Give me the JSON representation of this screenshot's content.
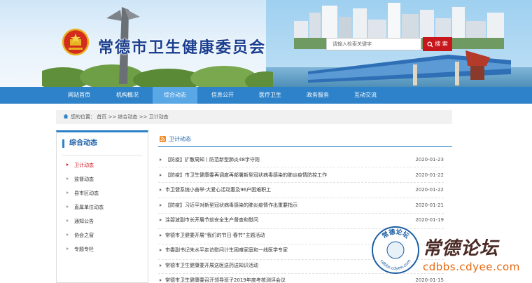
{
  "header": {
    "site_title": "常德市卫生健康委员会",
    "search": {
      "placeholder": "请输入检索关键字",
      "button_label": "搜 索"
    }
  },
  "nav": {
    "items": [
      {
        "label": "网站首页",
        "active": false
      },
      {
        "label": "机构概况",
        "active": false
      },
      {
        "label": "综合动态",
        "active": true
      },
      {
        "label": "信息公开",
        "active": false
      },
      {
        "label": "医疗卫生",
        "active": false
      },
      {
        "label": "政务服务",
        "active": false
      },
      {
        "label": "互动交流",
        "active": false
      }
    ]
  },
  "breadcrumb": {
    "text": "您的位置： 首页 >> 综合动态 >> 卫计动态"
  },
  "sidebar": {
    "title": "综合动态",
    "items": [
      {
        "label": "卫计动态",
        "active": true
      },
      {
        "label": "监督动态",
        "active": false
      },
      {
        "label": "县市区动态",
        "active": false
      },
      {
        "label": "直属单位动态",
        "active": false
      },
      {
        "label": "通知公告",
        "active": false
      },
      {
        "label": "协会之窗",
        "active": false
      },
      {
        "label": "专题专栏",
        "active": false
      }
    ]
  },
  "main": {
    "title": "卫计动态",
    "news": [
      {
        "title": "【防疫】扩散周知丨防范新型肺炎48字守则",
        "date": "2020-01-23"
      },
      {
        "title": "【防疫】市卫生健康委再调度再部署新型冠状病毒感染的肺炎疫情防控工作",
        "date": "2020-01-22"
      },
      {
        "title": "市卫健系统小善举·大爱心活动惠及96户困难职工",
        "date": "2020-01-22"
      },
      {
        "title": "【防疫】习近平对新型冠状病毒感染的肺炎疫情作出重要指示",
        "date": "2020-01-21"
      },
      {
        "title": "涂碧波副市长开展节前安全生产督查和慰问",
        "date": "2020-01-19"
      },
      {
        "title": "常德市卫健委开展“我们的节日·春节”主题活动",
        "date": ""
      },
      {
        "title": "市委副书记朱水平走访慰问计生困难家庭和一线医学专家",
        "date": ""
      },
      {
        "title": "常德市卫生健康委开展送医送药送知识活动",
        "date": ""
      },
      {
        "title": "常德市卫生健康委召开领导班子2019年度考核测评会议",
        "date": "2020-01-15"
      }
    ]
  },
  "watermark": {
    "logo_text": "常德论坛",
    "logo_url": "cdbbs.cdyee.com",
    "brand_text": "常德论坛",
    "url": "cdbbs.cdyee.com"
  },
  "colors": {
    "nav_bg": "#2d82c9",
    "nav_active": "#5aa7e6",
    "search_button": "#c8161d",
    "title_blue": "#1a3f8f",
    "active_red": "#d0161d"
  }
}
